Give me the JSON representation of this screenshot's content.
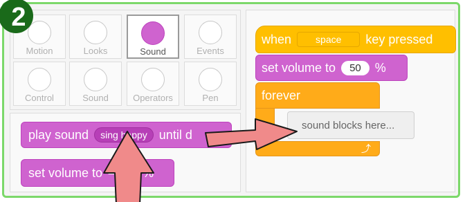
{
  "step_number": "2",
  "categories": [
    {
      "label": "Motion",
      "active": false
    },
    {
      "label": "Looks",
      "active": false
    },
    {
      "label": "Sound",
      "active": true
    },
    {
      "label": "Events",
      "active": false
    },
    {
      "label": "Control",
      "active": false
    },
    {
      "label": "Sound",
      "active": false
    },
    {
      "label": "Operators",
      "active": false
    },
    {
      "label": "Pen",
      "active": false
    }
  ],
  "palette_blocks": {
    "play_sound": {
      "prefix": "play sound",
      "sound": "sing happy",
      "suffix": "until d"
    },
    "set_volume": {
      "prefix": "set volume to",
      "suffix": "%"
    }
  },
  "script": {
    "hat": {
      "prefix": "when",
      "key": "space",
      "suffix": "key pressed"
    },
    "set_volume": {
      "prefix": "set volume to",
      "value": "50",
      "suffix": "%"
    },
    "forever_label": "forever",
    "placeholder": "sound blocks here...",
    "loop_arrow": "⤴"
  },
  "colors": {
    "sound": "#cf63cf",
    "events": "#ffbf00",
    "control": "#ffab19",
    "frame": "#7cd86a",
    "arrow": "#f08a8a"
  }
}
